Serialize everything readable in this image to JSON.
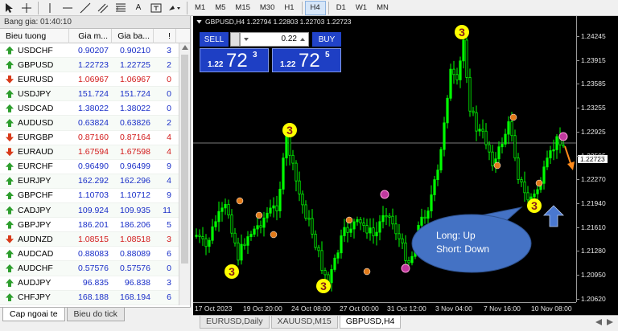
{
  "toolbar": {
    "timeframes": [
      {
        "label": "M1",
        "active": false
      },
      {
        "label": "M5",
        "active": false
      },
      {
        "label": "M15",
        "active": false
      },
      {
        "label": "M30",
        "active": false
      },
      {
        "label": "H1",
        "active": false
      },
      {
        "label": "H4",
        "active": true
      },
      {
        "label": "D1",
        "active": false
      },
      {
        "label": "W1",
        "active": false
      },
      {
        "label": "MN",
        "active": false
      }
    ],
    "icons": [
      "cursor-icon",
      "crosshair-icon",
      "vertical-line-icon",
      "horizontal-line-icon",
      "trendline-icon",
      "channel-icon",
      "fibonacci-icon",
      "text-icon",
      "text-label-icon",
      "arrow-shapes-icon"
    ],
    "text_tool_label": "A"
  },
  "market_watch": {
    "title": "Bang gia: 01:40:10",
    "columns": {
      "symbol": "Bieu tuong",
      "bid": "Gia m...",
      "ask": "Gia ba...",
      "spread": "!"
    },
    "rows": [
      {
        "symbol": "USDCHF",
        "bid": "0.90207",
        "ask": "0.90210",
        "spread": "3",
        "dir": "up"
      },
      {
        "symbol": "GBPUSD",
        "bid": "1.22723",
        "ask": "1.22725",
        "spread": "2",
        "dir": "up"
      },
      {
        "symbol": "EURUSD",
        "bid": "1.06967",
        "ask": "1.06967",
        "spread": "0",
        "dir": "down"
      },
      {
        "symbol": "USDJPY",
        "bid": "151.724",
        "ask": "151.724",
        "spread": "0",
        "dir": "up"
      },
      {
        "symbol": "USDCAD",
        "bid": "1.38022",
        "ask": "1.38022",
        "spread": "0",
        "dir": "up"
      },
      {
        "symbol": "AUDUSD",
        "bid": "0.63824",
        "ask": "0.63826",
        "spread": "2",
        "dir": "up"
      },
      {
        "symbol": "EURGBP",
        "bid": "0.87160",
        "ask": "0.87164",
        "spread": "4",
        "dir": "down"
      },
      {
        "symbol": "EURAUD",
        "bid": "1.67594",
        "ask": "1.67598",
        "spread": "4",
        "dir": "down"
      },
      {
        "symbol": "EURCHF",
        "bid": "0.96490",
        "ask": "0.96499",
        "spread": "9",
        "dir": "up"
      },
      {
        "symbol": "EURJPY",
        "bid": "162.292",
        "ask": "162.296",
        "spread": "4",
        "dir": "up"
      },
      {
        "symbol": "GBPCHF",
        "bid": "1.10703",
        "ask": "1.10712",
        "spread": "9",
        "dir": "up"
      },
      {
        "symbol": "CADJPY",
        "bid": "109.924",
        "ask": "109.935",
        "spread": "11",
        "dir": "up"
      },
      {
        "symbol": "GBPJPY",
        "bid": "186.201",
        "ask": "186.206",
        "spread": "5",
        "dir": "up"
      },
      {
        "symbol": "AUDNZD",
        "bid": "1.08515",
        "ask": "1.08518",
        "spread": "3",
        "dir": "down"
      },
      {
        "symbol": "AUDCAD",
        "bid": "0.88083",
        "ask": "0.88089",
        "spread": "6",
        "dir": "up"
      },
      {
        "symbol": "AUDCHF",
        "bid": "0.57576",
        "ask": "0.57576",
        "spread": "0",
        "dir": "up"
      },
      {
        "symbol": "AUDJPY",
        "bid": "96.835",
        "ask": "96.838",
        "spread": "3",
        "dir": "up"
      },
      {
        "symbol": "CHFJPY",
        "bid": "168.188",
        "ask": "168.194",
        "spread": "6",
        "dir": "up"
      }
    ],
    "tabs": [
      {
        "label": "Cap ngoai te",
        "active": true
      },
      {
        "label": "Bieu do tick",
        "active": false
      }
    ]
  },
  "chart": {
    "title": "GBPUSD,H4  1.22794 1.22803 1.22703 1.22723",
    "current_price": "1.22723",
    "one_click": {
      "sell_label": "SELL",
      "buy_label": "BUY",
      "lot": "0.22",
      "sell_small": "1.22",
      "sell_big": "72",
      "sell_sup": "3",
      "buy_small": "1.22",
      "buy_big": "72",
      "buy_sup": "5"
    },
    "price_labels": [
      "1.24245",
      "1.23915",
      "1.23585",
      "1.23255",
      "1.22925",
      "1.22595",
      "1.22270",
      "1.21940",
      "1.21610",
      "1.21280",
      "1.20950",
      "1.20620"
    ],
    "time_labels": [
      "17 Oct 2023",
      "19 Oct 20:00",
      "24 Oct 08:00",
      "27 Oct 00:00",
      "31 Oct 12:00",
      "3 Nov 04:00",
      "7 Nov 16:00",
      "10 Nov 08:00"
    ],
    "wave_label": "3",
    "annotation": {
      "line1": "Long: Up",
      "line2": "Short: Down"
    },
    "colors": {
      "candle": "#00ff00",
      "wave_badge": "#ffff00",
      "dot_orange": "#e07a1a",
      "dot_magenta": "#c0399e",
      "bubble": "#4472c4",
      "arrow_blue": "#4a78d0",
      "arrow_orange": "#ff8a1a"
    }
  },
  "chart_tabs": [
    {
      "label": "EURUSD,Daily",
      "active": false
    },
    {
      "label": "XAUUSD,M15",
      "active": false
    },
    {
      "label": "GBPUSD,H4",
      "active": true
    }
  ]
}
